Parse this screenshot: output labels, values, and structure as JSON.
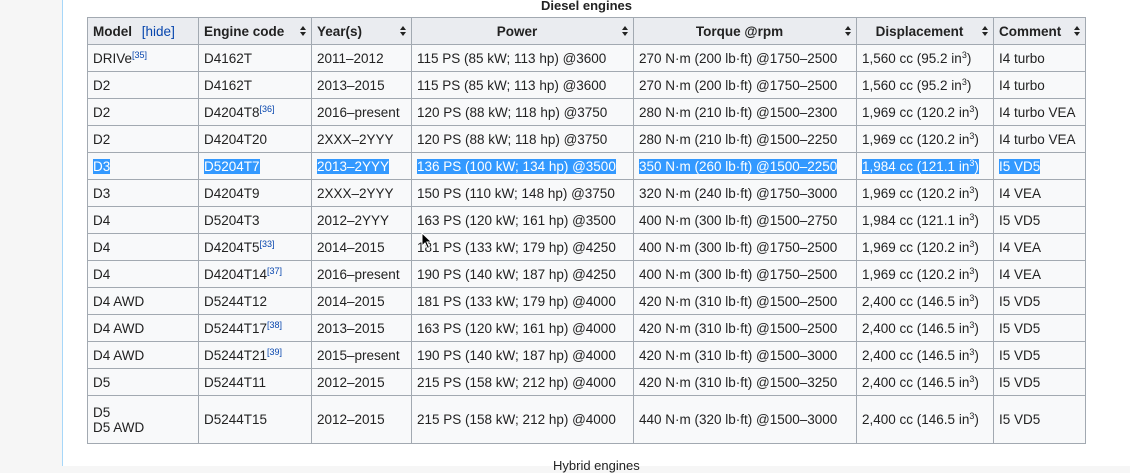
{
  "caption": "Diesel engines",
  "header": {
    "model": "Model",
    "hide_open": "[",
    "hide": "hide",
    "hide_close": "]",
    "engine_code": "Engine code",
    "years": "Year(s)",
    "power": "Power",
    "torque": "Torque @rpm",
    "displacement": "Displacement",
    "comment": "Comment"
  },
  "rows": [
    {
      "model": "DRIVe",
      "model_ref": "[35]",
      "code": "D4162T",
      "years": "2011–2012",
      "power": "115 PS (85 kW; 113 hp) @3600",
      "torque": "270 N·m (200 lb·ft) @1750–2500",
      "disp": "1,560 cc (95.2 in",
      "disp_sup": "3",
      "disp_end": ")",
      "comment": "I4 turbo"
    },
    {
      "model": "D2",
      "code": "D4162T",
      "years": "2013–2015",
      "power": "115 PS (85 kW; 113 hp) @3600",
      "torque": "270 N·m (200 lb·ft) @1750–2500",
      "disp": "1,560 cc (95.2 in",
      "disp_sup": "3",
      "disp_end": ")",
      "comment": "I4 turbo"
    },
    {
      "model": "D2",
      "code": "D4204T8",
      "code_ref": "[36]",
      "years": "2016–present",
      "power": "120 PS (88 kW; 118 hp) @3750",
      "torque": "280 N·m (210 lb·ft) @1500–2300",
      "disp": "1,969 cc (120.2 in",
      "disp_sup": "3",
      "disp_end": ")",
      "comment": "I4 turbo VEA"
    },
    {
      "model": "D2",
      "code": "D4204T20",
      "years": "2XXX–2YYY",
      "power": "120 PS (88 kW; 118 hp) @3750",
      "torque": "280 N·m (210 lb·ft) @1500–2250",
      "disp": "1,969 cc (120.2 in",
      "disp_sup": "3",
      "disp_end": ")",
      "comment": "I4 turbo VEA"
    },
    {
      "model": "D3",
      "code": "D5204T7",
      "years": "2013–2YYY",
      "power": "136 PS (100 kW; 134 hp) @3500",
      "torque": "350 N·m (260 lb·ft) @1500–2250",
      "disp": "1,984 cc (121.1 in",
      "disp_sup": "3",
      "disp_end": ")",
      "comment": "I5 VD5"
    },
    {
      "model": "D3",
      "code": "D4204T9",
      "years": "2XXX–2YYY",
      "power": "150 PS (110 kW; 148 hp) @3750",
      "torque": "320 N·m (240 lb·ft) @1750–3000",
      "disp": "1,969 cc (120.2 in",
      "disp_sup": "3",
      "disp_end": ")",
      "comment": "I4 VEA"
    },
    {
      "model": "D4",
      "code": "D5204T3",
      "years": "2012–2YYY",
      "power": "163 PS (120 kW; 161 hp) @3500",
      "torque": "400 N·m (300 lb·ft) @1500–2750",
      "disp": "1,984 cc (121.1 in",
      "disp_sup": "3",
      "disp_end": ")",
      "comment": "I5 VD5"
    },
    {
      "model": "D4",
      "code": "D4204T5",
      "code_ref": "[33]",
      "years": "2014–2015",
      "power": "181 PS (133 kW; 179 hp) @4250",
      "torque": "400 N·m (300 lb·ft) @1750–2500",
      "disp": "1,969 cc (120.2 in",
      "disp_sup": "3",
      "disp_end": ")",
      "comment": "I4 VEA"
    },
    {
      "model": "D4",
      "code": "D4204T14",
      "code_ref": "[37]",
      "years": "2016–present",
      "power": "190 PS (140 kW; 187 hp) @4250",
      "torque": "400 N·m (300 lb·ft) @1750–2500",
      "disp": "1,969 cc (120.2 in",
      "disp_sup": "3",
      "disp_end": ")",
      "comment": "I4 VEA"
    },
    {
      "model": "D4 AWD",
      "code": "D5244T12",
      "years": "2014–2015",
      "power": "181 PS (133 kW; 179 hp) @4000",
      "torque": "420 N·m (310 lb·ft) @1500–2500",
      "disp": "2,400 cc (146.5 in",
      "disp_sup": "3",
      "disp_end": ")",
      "comment": "I5 VD5"
    },
    {
      "model": "D4 AWD",
      "code": "D5244T17",
      "code_ref": "[38]",
      "years": "2013–2015",
      "power": "163 PS (120 kW; 161 hp) @4000",
      "torque": "420 N·m (310 lb·ft) @1500–2500",
      "disp": "2,400 cc (146.5 in",
      "disp_sup": "3",
      "disp_end": ")",
      "comment": "I5 VD5"
    },
    {
      "model": "D4 AWD",
      "code": "D5244T21",
      "code_ref": "[39]",
      "years": "2015–present",
      "power": "190 PS (140 kW; 187 hp) @4000",
      "torque": "420 N·m (310 lb·ft) @1500–3000",
      "disp": "2,400 cc (146.5 in",
      "disp_sup": "3",
      "disp_end": ")",
      "comment": "I5 VD5"
    },
    {
      "model": "D5",
      "code": "D5244T11",
      "years": "2012–2015",
      "power": "215 PS (158 kW; 212 hp) @4000",
      "torque": "420 N·m (310 lb·ft) @1500–3250",
      "disp": "2,400 cc (146.5 in",
      "disp_sup": "3",
      "disp_end": ")",
      "comment": "I5 VD5"
    },
    {
      "model": "D5",
      "model_line2": "D5 AWD",
      "code": "D5244T15",
      "years": "2012–2015",
      "power": "215 PS (158 kW; 212 hp) @4000",
      "torque": "440 N·m (320 lb·ft) @1500–3000",
      "disp": "2,400 cc (146.5 in",
      "disp_sup": "3",
      "disp_end": ")",
      "comment": "I5 VD5"
    }
  ],
  "selected_row_index": 4,
  "below_text": "Hybrid engines",
  "colors": {
    "selection": "#3399ff",
    "link": "#0645ad",
    "header_bg": "#eaecf0",
    "border": "#a2a9b1"
  },
  "icons": {
    "sort": "sort-both-icon",
    "cursor": "mouse-cursor-icon"
  }
}
